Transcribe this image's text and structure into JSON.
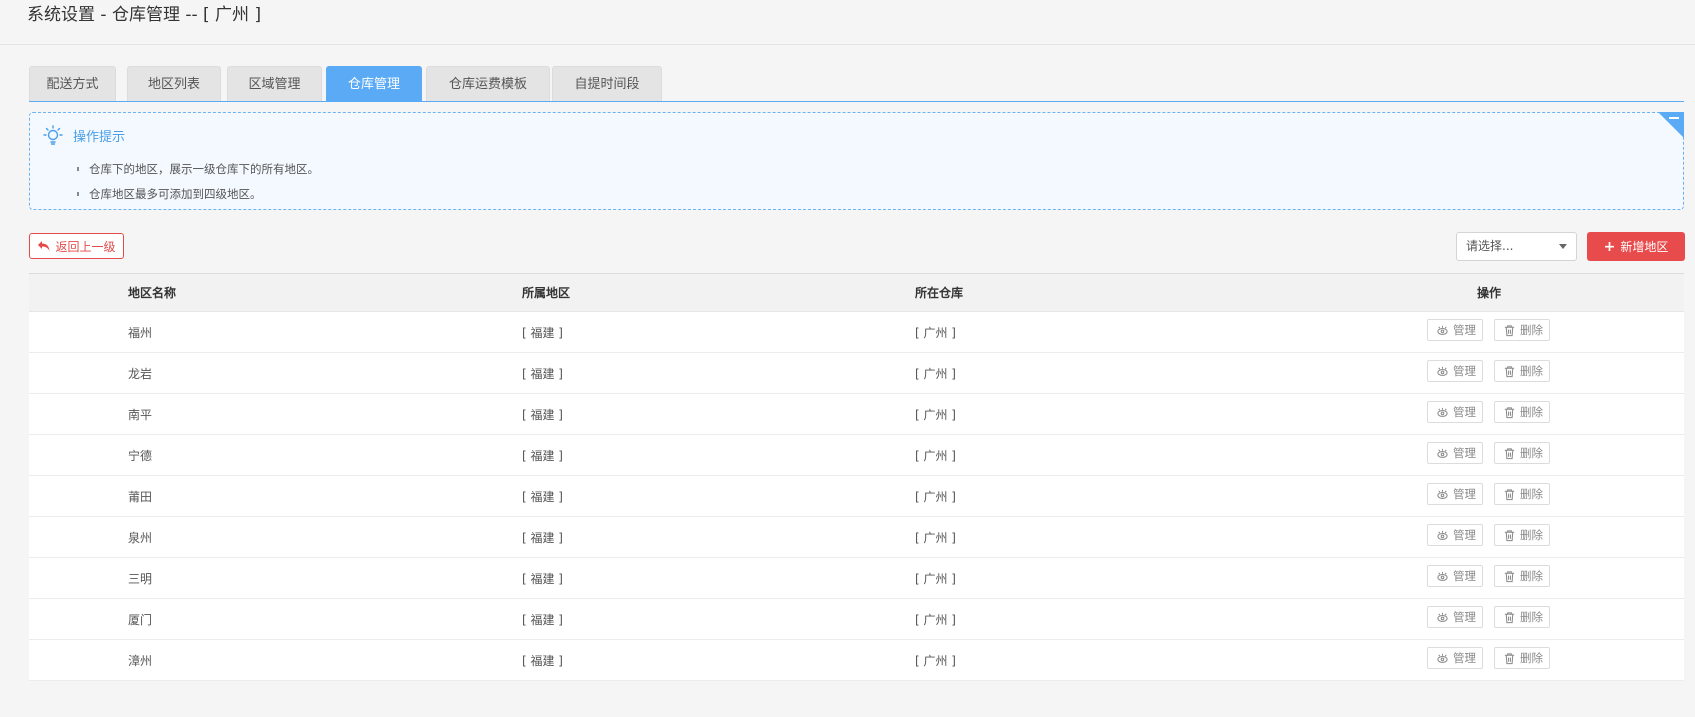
{
  "header": {
    "title": "系统设置 - 仓库管理  --  [ 广州 ]"
  },
  "tabs": [
    {
      "label": "配送方式",
      "active": false
    },
    {
      "label": "地区列表",
      "active": false
    },
    {
      "label": "区域管理",
      "active": false
    },
    {
      "label": "仓库管理",
      "active": true
    },
    {
      "label": "仓库运费模板",
      "active": false
    },
    {
      "label": "自提时间段",
      "active": false
    }
  ],
  "tips": {
    "title": "操作提示",
    "items": [
      "仓库下的地区，展示一级仓库下的所有地区。",
      "仓库地区最多可添加到四级地区。"
    ]
  },
  "toolbar": {
    "back_label": "返回上一级",
    "select_placeholder": "请选择...",
    "add_label": "新增地区"
  },
  "table": {
    "headers": {
      "name": "地区名称",
      "region": "所属地区",
      "warehouse": "所在仓库",
      "actions": "操作"
    },
    "manage_label": "管理",
    "delete_label": "删除",
    "rows": [
      {
        "name": "福州",
        "region": "[ 福建 ]",
        "warehouse": "[ 广州 ]"
      },
      {
        "name": "龙岩",
        "region": "[ 福建 ]",
        "warehouse": "[ 广州 ]"
      },
      {
        "name": "南平",
        "region": "[ 福建 ]",
        "warehouse": "[ 广州 ]"
      },
      {
        "name": "宁德",
        "region": "[ 福建 ]",
        "warehouse": "[ 广州 ]"
      },
      {
        "name": "莆田",
        "region": "[ 福建 ]",
        "warehouse": "[ 广州 ]"
      },
      {
        "name": "泉州",
        "region": "[ 福建 ]",
        "warehouse": "[ 广州 ]"
      },
      {
        "name": "三明",
        "region": "[ 福建 ]",
        "warehouse": "[ 广州 ]"
      },
      {
        "name": "厦门",
        "region": "[ 福建 ]",
        "warehouse": "[ 广州 ]"
      },
      {
        "name": "漳州",
        "region": "[ 福建 ]",
        "warehouse": "[ 广州 ]"
      }
    ]
  },
  "colors": {
    "accent": "#5aaaf5",
    "danger": "#e84b4b"
  }
}
